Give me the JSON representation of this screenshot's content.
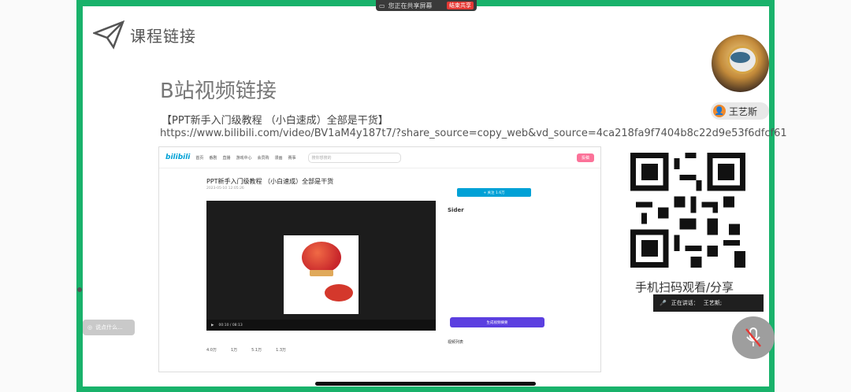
{
  "share_bar": {
    "status": "您正在共享屏幕",
    "stop_label": "结束共享"
  },
  "slide": {
    "heading": "课程链接",
    "section_title": "B站视频链接",
    "subtitle": "【PPT新手入门级教程 （小白速成）全部是干货】",
    "url": "https://www.bilibili.com/video/BV1aM4y187t7/?share_source=copy_web&vd_source=4ca218fa9f7404b8c22d9e53f6dfcf61",
    "qr_caption": "手机扫码观看/分享"
  },
  "bilibili": {
    "logo": "bilibili",
    "nav": [
      "首页",
      "番剧",
      "直播",
      "游戏中心",
      "会员购",
      "漫画",
      "赛事"
    ],
    "search_placeholder": "搜你想搜的",
    "upload_label": "投稿",
    "video_title": "PPT新手入门级教程 （小白速成）全部是干货",
    "meta": "2023-05-10 12:05:26",
    "follow_label": "+ 关注 1.6万",
    "sider_name": "Sider",
    "sider_button": "生成视频摘要",
    "time": "00:10 / 08:13",
    "likes": "4.0万",
    "coins": "1万",
    "favorites": "5.1万",
    "shares": "1.3万",
    "playlist_label": "视频列表"
  },
  "participant": {
    "name": "王艺斯",
    "speaking_label": "正在讲话：",
    "speaking_name": "王艺斯;"
  },
  "chat_hint": "说点什么..."
}
